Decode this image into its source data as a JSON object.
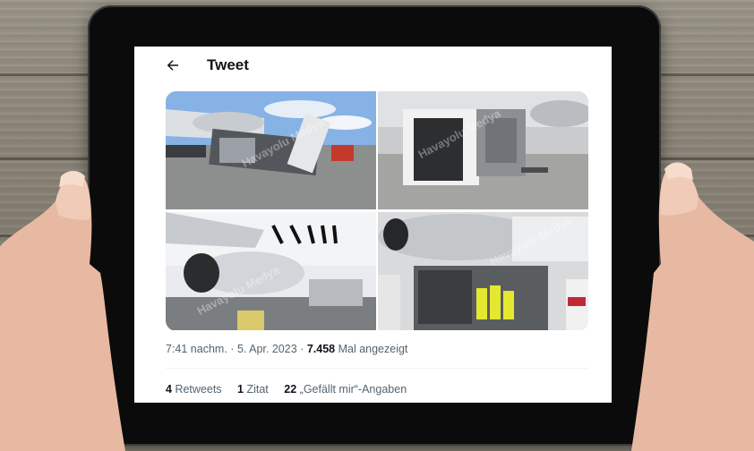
{
  "header": {
    "title": "Tweet",
    "back_icon": "arrow-left-icon"
  },
  "media": {
    "watermark": "Havayolu Medya",
    "images": [
      "airplane-with-overturned-catering-truck",
      "overturned-catering-truck-close-up",
      "airplane-engine-and-wing",
      "workers-near-overturned-truck"
    ]
  },
  "tweet_meta": {
    "time": "7:41 nachm.",
    "separator": "·",
    "date": "5. Apr. 2023",
    "views_count": "7.458",
    "views_label": "Mal angezeigt"
  },
  "stats": {
    "retweets_count": "4",
    "retweets_label": "Retweets",
    "quotes_count": "1",
    "quotes_label": "Zitat",
    "likes_count": "22",
    "likes_label": "„Gefällt mir“-Angaben"
  },
  "colors": {
    "text_primary": "#0f1419",
    "text_secondary": "#536471",
    "divider": "#eff3f4"
  }
}
